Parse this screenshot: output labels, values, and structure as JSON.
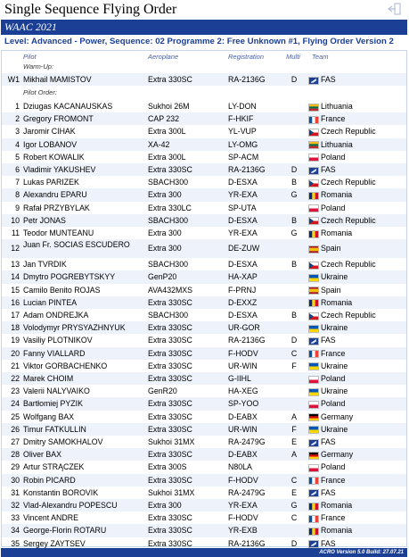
{
  "header": {
    "title": "Single Sequence Flying Order",
    "banner": "WAAC 2021",
    "subtitle": "Level: Advanced - Power, Sequence: 02 Programme 2: Free Unknown #1, Flying Order Version 2"
  },
  "columns": {
    "pilot": "Pilot",
    "aeroplane": "Aeroplane",
    "registration": "Registration",
    "multi": "Multi",
    "team": "Team"
  },
  "sections": {
    "warmup": "Warm-Up:",
    "order": "Pilot Order:"
  },
  "flags": {
    "FAS": {
      "type": "fas",
      "colors": [
        "#1b3f94",
        "#ffffff"
      ]
    },
    "Lithuania": {
      "type": "h3",
      "colors": [
        "#fdb913",
        "#006a44",
        "#c1272d"
      ]
    },
    "France": {
      "type": "v3",
      "colors": [
        "#0055a4",
        "#ffffff",
        "#ef4135"
      ]
    },
    "Czech Republic": {
      "type": "cz",
      "colors": [
        "#ffffff",
        "#d7141a",
        "#11457e"
      ]
    },
    "Poland": {
      "type": "h2",
      "colors": [
        "#ffffff",
        "#dc143c"
      ]
    },
    "Romania": {
      "type": "v3",
      "colors": [
        "#002b7f",
        "#fcd116",
        "#ce1126"
      ]
    },
    "Ukraine": {
      "type": "h2",
      "colors": [
        "#0057b7",
        "#ffd700"
      ]
    },
    "Spain": {
      "type": "es",
      "colors": [
        "#aa151b",
        "#f1bf00",
        "#aa151b"
      ]
    },
    "Germany": {
      "type": "h3",
      "colors": [
        "#000000",
        "#dd0000",
        "#ffce00"
      ]
    }
  },
  "warmup": [
    {
      "no": "W1",
      "pilot": "Mikhail MAMISTOV",
      "plane": "Extra 330SC",
      "reg": "RA-2136G",
      "multi": "D",
      "team": "FAS"
    }
  ],
  "rows": [
    {
      "no": "1",
      "pilot": "Dziugas KACANAUSKAS",
      "plane": "Sukhoi 26M",
      "reg": "LY-DON",
      "multi": "",
      "team": "Lithuania"
    },
    {
      "no": "2",
      "pilot": "Gregory FROMONT",
      "plane": "CAP 232",
      "reg": "F-HKIF",
      "multi": "",
      "team": "France"
    },
    {
      "no": "3",
      "pilot": "Jaromir CIHAK",
      "plane": "Extra 300L",
      "reg": "YL-VUP",
      "multi": "",
      "team": "Czech Republic"
    },
    {
      "no": "4",
      "pilot": "Igor LOBANOV",
      "plane": "XA-42",
      "reg": "LY-OMG",
      "multi": "",
      "team": "Lithuania"
    },
    {
      "no": "5",
      "pilot": "Robert KOWALIK",
      "plane": "Extra 300L",
      "reg": "SP-ACM",
      "multi": "",
      "team": "Poland"
    },
    {
      "no": "6",
      "pilot": "Vladimir YAKUSHEV",
      "plane": "Extra 330SC",
      "reg": "RA-2136G",
      "multi": "D",
      "team": "FAS"
    },
    {
      "no": "7",
      "pilot": "Lukas PARIZEK",
      "plane": "SBACH300",
      "reg": "D-ESXA",
      "multi": "B",
      "team": "Czech Republic"
    },
    {
      "no": "8",
      "pilot": "Alexandru EPARU",
      "plane": "Extra 300",
      "reg": "YR-EXA",
      "multi": "G",
      "team": "Romania"
    },
    {
      "no": "9",
      "pilot": "Rafał PRZYBYLAK",
      "plane": "Extra 330LC",
      "reg": "SP-UTA",
      "multi": "",
      "team": "Poland"
    },
    {
      "no": "10",
      "pilot": "Petr JONAS",
      "plane": "SBACH300",
      "reg": "D-ESXA",
      "multi": "B",
      "team": "Czech Republic"
    },
    {
      "no": "11",
      "pilot": "Teodor MUNTEANU",
      "plane": "Extra 300",
      "reg": "YR-EXA",
      "multi": "G",
      "team": "Romania"
    },
    {
      "no": "12",
      "pilot": "Juan Fr. SOCIAS ESCUDERO",
      "plane": "Extra 300",
      "reg": "DE-ZUW",
      "multi": "",
      "team": "Spain",
      "two": true
    },
    {
      "no": "13",
      "pilot": "Jan TVRDIK",
      "plane": "SBACH300",
      "reg": "D-ESXA",
      "multi": "B",
      "team": "Czech Republic"
    },
    {
      "no": "14",
      "pilot": "Dmytro POGREBYTSKYY",
      "plane": "GenP20",
      "reg": "HA-XAP",
      "multi": "",
      "team": "Ukraine"
    },
    {
      "no": "15",
      "pilot": "Camilo Benito ROJAS",
      "plane": "AVA432MXS",
      "reg": "F-PRNJ",
      "multi": "",
      "team": "Spain"
    },
    {
      "no": "16",
      "pilot": "Lucian PINTEA",
      "plane": "Extra 330SC",
      "reg": "D-EXXZ",
      "multi": "",
      "team": "Romania"
    },
    {
      "no": "17",
      "pilot": "Adam ONDREJKA",
      "plane": "SBACH300",
      "reg": "D-ESXA",
      "multi": "B",
      "team": "Czech Republic"
    },
    {
      "no": "18",
      "pilot": "Volodymyr PRYSYAZHNYUK",
      "plane": "Extra 330SC",
      "reg": "UR-GOR",
      "multi": "",
      "team": "Ukraine"
    },
    {
      "no": "19",
      "pilot": "Vasiliy PLOTNIKOV",
      "plane": "Extra 330SC",
      "reg": "RA-2136G",
      "multi": "D",
      "team": "FAS"
    },
    {
      "no": "20",
      "pilot": "Fanny VIALLARD",
      "plane": "Extra 330SC",
      "reg": "F-HODV",
      "multi": "C",
      "team": "France"
    },
    {
      "no": "21",
      "pilot": "Viktor GORBACHENKO",
      "plane": "Extra 330SC",
      "reg": "UR-WIN",
      "multi": "F",
      "team": "Ukraine"
    },
    {
      "no": "22",
      "pilot": "Marek CHOIM",
      "plane": "Extra 330SC",
      "reg": "G-IIHL",
      "multi": "",
      "team": "Poland"
    },
    {
      "no": "23",
      "pilot": "Valerii NALYVAIKO",
      "plane": "GenR20",
      "reg": "HA-XEG",
      "multi": "",
      "team": "Ukraine"
    },
    {
      "no": "24",
      "pilot": "Bartłomiej PYZIK",
      "plane": "Extra 330SC",
      "reg": "SP-YOO",
      "multi": "",
      "team": "Poland"
    },
    {
      "no": "25",
      "pilot": "Wolfgang BAX",
      "plane": "Extra 330SC",
      "reg": "D-EABX",
      "multi": "A",
      "team": "Germany"
    },
    {
      "no": "26",
      "pilot": "Timur FATKULLIN",
      "plane": "Extra 330SC",
      "reg": "UR-WIN",
      "multi": "F",
      "team": "Ukraine"
    },
    {
      "no": "27",
      "pilot": "Dmitry SAMOKHALOV",
      "plane": "Sukhoi 31MX",
      "reg": "RA-2479G",
      "multi": "E",
      "team": "FAS"
    },
    {
      "no": "28",
      "pilot": "Oliver BAX",
      "plane": "Extra 330SC",
      "reg": "D-EABX",
      "multi": "A",
      "team": "Germany"
    },
    {
      "no": "29",
      "pilot": "Artur STRĄCZEK",
      "plane": "Extra 300S",
      "reg": "N80LA",
      "multi": "",
      "team": "Poland"
    },
    {
      "no": "30",
      "pilot": "Robin PICARD",
      "plane": "Extra 330SC",
      "reg": "F-HODV",
      "multi": "C",
      "team": "France"
    },
    {
      "no": "31",
      "pilot": "Konstantin BOROVIK",
      "plane": "Sukhoi 31MX",
      "reg": "RA-2479G",
      "multi": "E",
      "team": "FAS"
    },
    {
      "no": "32",
      "pilot": "Vlad-Alexandru POPESCU",
      "plane": "Extra 300",
      "reg": "YR-EXA",
      "multi": "G",
      "team": "Romania"
    },
    {
      "no": "33",
      "pilot": "Vincent ANDRE",
      "plane": "Extra 330SC",
      "reg": "F-HODV",
      "multi": "C",
      "team": "France"
    },
    {
      "no": "34",
      "pilot": "George-Florin ROTARU",
      "plane": "Extra 330SC",
      "reg": "YR-EXB",
      "multi": "",
      "team": "Romania"
    },
    {
      "no": "35",
      "pilot": "Sergey ZAYTSEV",
      "plane": "Extra 330SC",
      "reg": "RA-2136G",
      "multi": "D",
      "team": "FAS"
    }
  ],
  "footer": {
    "version": "ACRO Version 5.0 Build: 27.07.21"
  }
}
